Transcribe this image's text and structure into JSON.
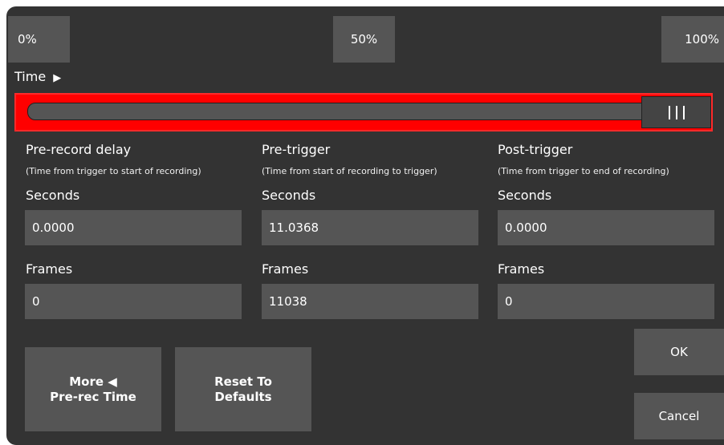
{
  "presets": {
    "zero": "0%",
    "fifty": "50%",
    "hundred": "100%"
  },
  "time_label": "Time",
  "time_arrow": "▶",
  "slider": {
    "value_fraction": 1.0,
    "grip_glyph": "|||",
    "accent_color": "#ff0000"
  },
  "columns": [
    {
      "title": "Pre-record delay",
      "subtitle": "(Time from trigger to start of recording)",
      "seconds_label": "Seconds",
      "seconds_value": "0.0000",
      "frames_label": "Frames",
      "frames_value": "0"
    },
    {
      "title": "Pre-trigger",
      "subtitle": "(Time from start of recording to trigger)",
      "seconds_label": "Seconds",
      "seconds_value": "11.0368",
      "frames_label": "Frames",
      "frames_value": "11038"
    },
    {
      "title": "Post-trigger",
      "subtitle": "(Time from trigger to end of recording)",
      "seconds_label": "Seconds",
      "seconds_value": "0.0000",
      "frames_label": "Frames",
      "frames_value": "0"
    }
  ],
  "buttons": {
    "more_line1": "More ◀",
    "more_line2": "Pre-rec Time",
    "reset_line1": "Reset To",
    "reset_line2": "Defaults",
    "ok": "OK",
    "cancel": "Cancel"
  }
}
